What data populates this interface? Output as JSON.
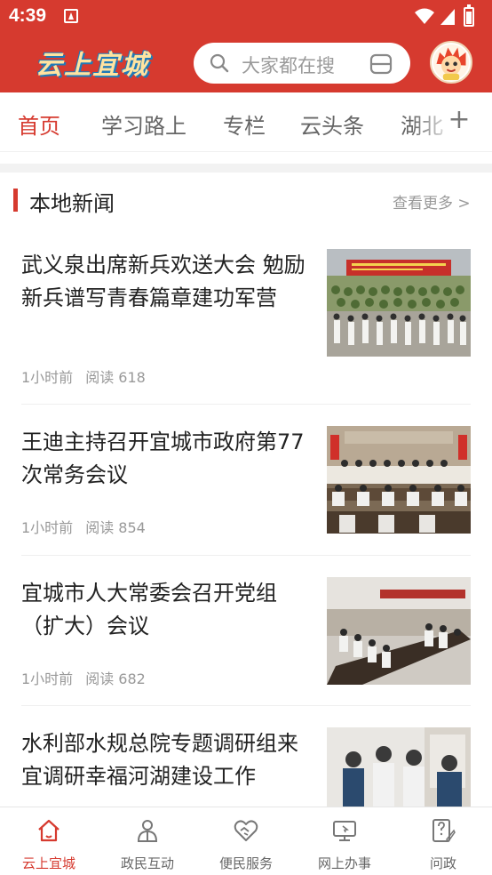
{
  "status_bar": {
    "time": "4:39"
  },
  "header": {
    "logo_text": "云上宜城",
    "search_placeholder": "大家都在搜",
    "brand_color": "#d63a2f"
  },
  "tabs": [
    {
      "label": "首页",
      "active": true
    },
    {
      "label": "学习路上",
      "active": false
    },
    {
      "label": "专栏",
      "active": false
    },
    {
      "label": "云头条",
      "active": false
    },
    {
      "label": "湖北",
      "active": false
    }
  ],
  "section": {
    "title": "本地新闻",
    "more": "查看更多 >"
  },
  "news": [
    {
      "title": "武义泉出席新兵欢送大会 勉励新兵谱写青春篇章建功军营",
      "time": "1小时前",
      "reads": "阅读 618"
    },
    {
      "title": " 王迪主持召开宜城市政府第77次常务会议",
      "time": "1小时前",
      "reads": "阅读 854"
    },
    {
      "title": "宜城市人大常委会召开党组（扩大）会议",
      "time": "1小时前",
      "reads": "阅读 682"
    },
    {
      "title": "水利部水规总院专题调研组来宜调研幸福河湖建设工作",
      "time": "",
      "reads": ""
    }
  ],
  "bottom_nav": [
    {
      "label": "云上宜城",
      "icon": "home-icon",
      "active": true
    },
    {
      "label": "政民互动",
      "icon": "person-icon",
      "active": false
    },
    {
      "label": "便民服务",
      "icon": "handshake-heart-icon",
      "active": false
    },
    {
      "label": "网上办事",
      "icon": "monitor-icon",
      "active": false
    },
    {
      "label": "问政",
      "icon": "question-edit-icon",
      "active": false
    }
  ]
}
